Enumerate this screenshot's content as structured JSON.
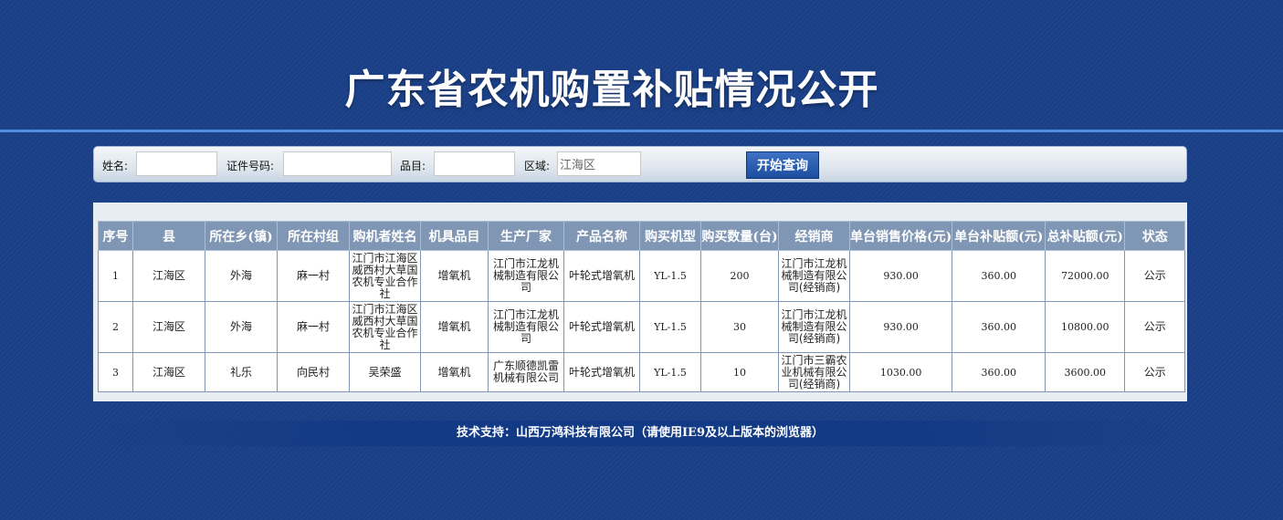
{
  "page": {
    "title": "广东省农机购置补贴情况公开"
  },
  "search": {
    "name_label": "姓名:",
    "name_value": "",
    "id_label": "证件号码:",
    "id_value": "",
    "item_label": "品目:",
    "item_value": "",
    "region_label": "区域:",
    "region_value": "江海区",
    "submit_label": "开始查询"
  },
  "table": {
    "headers": [
      "序号",
      "县",
      "所在乡(镇)",
      "所在村组",
      "购机者姓名",
      "机具品目",
      "生产厂家",
      "产品名称",
      "购买机型",
      "购买数量(台)",
      "经销商",
      "单台销售价格(元)",
      "单台补贴额(元)",
      "总补贴额(元)",
      "状态"
    ],
    "rows": [
      [
        "1",
        "江海区",
        "外海",
        "麻一村",
        "江门市江海区威西村大草国农机专业合作社",
        "增氧机",
        "江门市江龙机械制造有限公司",
        "叶轮式增氧机",
        "YL-1.5",
        "200",
        "江门市江龙机械制造有限公司(经销商)",
        "930.00",
        "360.00",
        "72000.00",
        "公示"
      ],
      [
        "2",
        "江海区",
        "外海",
        "麻一村",
        "江门市江海区威西村大草国农机专业合作社",
        "增氧机",
        "江门市江龙机械制造有限公司",
        "叶轮式增氧机",
        "YL-1.5",
        "30",
        "江门市江龙机械制造有限公司(经销商)",
        "930.00",
        "360.00",
        "10800.00",
        "公示"
      ],
      [
        "3",
        "江海区",
        "礼乐",
        "向民村",
        "吴荣盛",
        "增氧机",
        "广东顺德凯雷机械有限公司",
        "叶轮式增氧机",
        "YL-1.5",
        "10",
        "江门市三霸农业机械有限公司(经销商)",
        "1030.00",
        "360.00",
        "3600.00",
        "公示"
      ]
    ]
  },
  "footer": {
    "text": "技术支持：山西万鸿科技有限公司（请使用IE9及以上版本的浏览器）"
  }
}
